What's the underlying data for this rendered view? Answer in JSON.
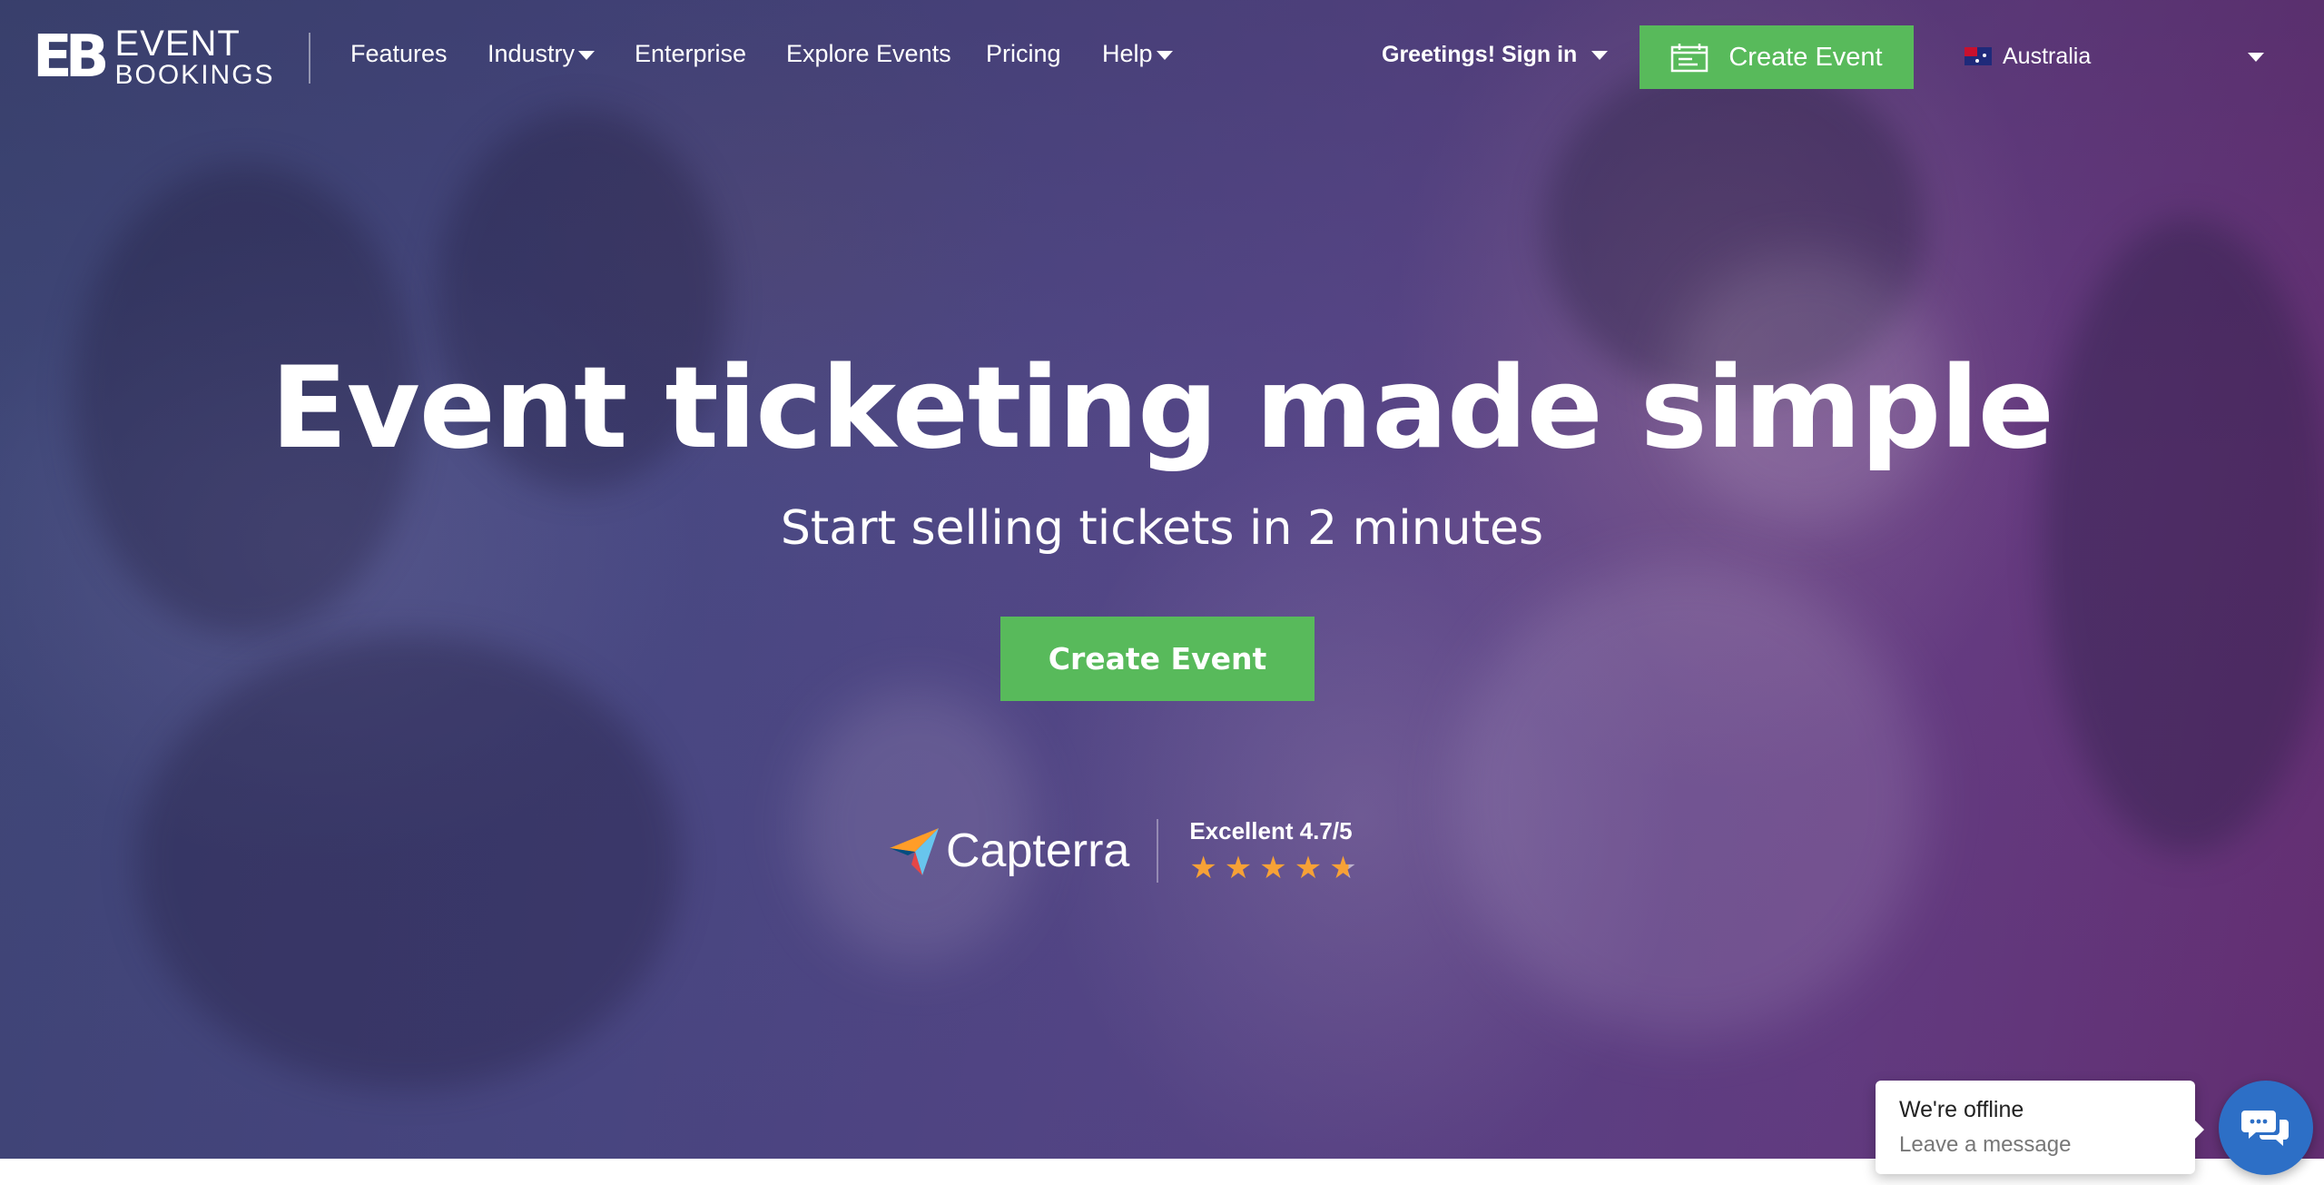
{
  "brand": {
    "mark": "EB",
    "line1": "EVENT",
    "line2": "BOOKINGS"
  },
  "nav": {
    "features": "Features",
    "industry": "Industry",
    "enterprise": "Enterprise",
    "explore": "Explore Events",
    "pricing": "Pricing",
    "help": "Help",
    "signin": "Greetings! Sign in",
    "create_event": "Create Event",
    "country": "Australia"
  },
  "hero": {
    "headline": "Event ticketing made simple",
    "subhead": "Start selling tickets in 2 minutes",
    "cta": "Create Event"
  },
  "review": {
    "brand": "Capterra",
    "label": "Excellent 4.7/5",
    "rating": 4.7,
    "max": 5,
    "star_color": "#f7a136"
  },
  "chat": {
    "title": "We're offline",
    "subtitle": "Leave a message",
    "button_color": "#2d6fc6"
  },
  "colors": {
    "accent_green": "#58ba5b"
  },
  "icons": {
    "create_event": "calendar-icon",
    "chat": "chat-bubbles-icon",
    "flag": "australia-flag-icon"
  }
}
